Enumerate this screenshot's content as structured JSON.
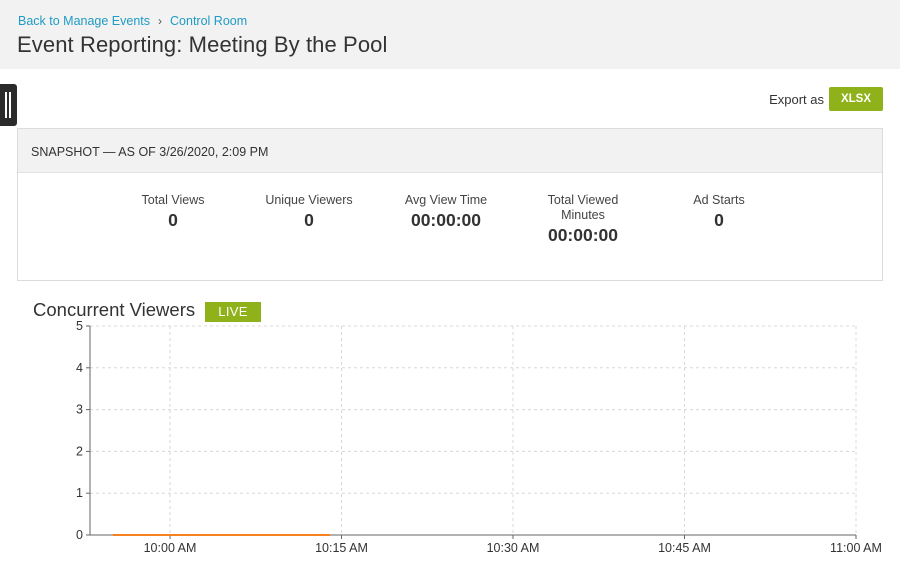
{
  "header": {
    "breadcrumb": {
      "back_link": "Back to Manage Events",
      "separator": "›",
      "current_link": "Control Room"
    },
    "title": "Event Reporting: Meeting By the Pool"
  },
  "export": {
    "label": "Export as",
    "button": "XLSX",
    "accent_color": "#8fb21a"
  },
  "snapshot": {
    "heading": "SNAPSHOT — AS OF 3/26/2020, 2:09 PM",
    "stats": [
      {
        "label": "Total Views",
        "value": "0"
      },
      {
        "label": "Unique Viewers",
        "value": "0"
      },
      {
        "label": "Avg View Time",
        "value": "00:00:00"
      },
      {
        "label": "Total Viewed Minutes",
        "value": "00:00:00"
      },
      {
        "label": "Ad Starts",
        "value": "0"
      }
    ]
  },
  "chart": {
    "title": "Concurrent Viewers",
    "badge": "LIVE"
  },
  "chart_data": {
    "type": "line",
    "title": "Concurrent Viewers",
    "xlabel": "",
    "ylabel": "",
    "x_ticks": [
      "10:00 AM",
      "10:15 AM",
      "10:30 AM",
      "10:45 AM",
      "11:00 AM"
    ],
    "y_ticks": [
      "0",
      "1",
      "2",
      "3",
      "4",
      "5"
    ],
    "ylim": [
      0,
      5
    ],
    "xlim": [
      "9:53 AM",
      "11:00 AM"
    ],
    "grid": true,
    "series": [
      {
        "color": "#f5821f",
        "points": [
          {
            "x": "9:55 AM",
            "y": 0
          },
          {
            "x": "10:14 AM",
            "y": 0
          }
        ]
      }
    ]
  }
}
